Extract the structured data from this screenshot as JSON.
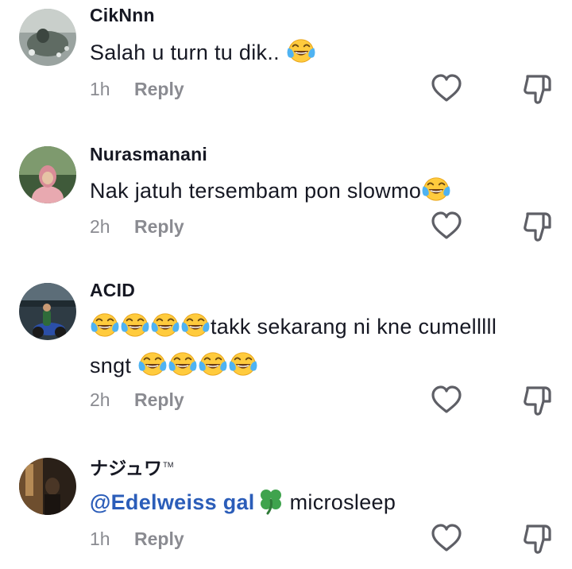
{
  "accent_colors": {
    "mention": "#2B5DB9",
    "meta_gray": "#8A8B91",
    "text": "#161823"
  },
  "comments": [
    {
      "username": "CikNnn",
      "text_parts": [
        "Salah u turn tu dik.. "
      ],
      "time": "1h",
      "reply_label": "Reply",
      "emojis": [
        "face-with-tears-of-joy"
      ]
    },
    {
      "username": "Nurasmanani",
      "text_parts": [
        "Nak jatuh tersembam pon slowmo"
      ],
      "time": "2h",
      "reply_label": "Reply",
      "emojis": [
        "face-with-tears-of-joy"
      ]
    },
    {
      "username": "ACID",
      "text_parts": [
        "takk sekarang ni kne cumelllll",
        "sngt "
      ],
      "time": "2h",
      "reply_label": "Reply",
      "emojis": [
        "face-with-tears-of-joy"
      ]
    },
    {
      "username": "ナジュワ",
      "username_suffix": "TM",
      "mention": "@Edelweiss  gal",
      "text_parts": [
        "microsleep"
      ],
      "time": "1h",
      "reply_label": "Reply",
      "emojis": [
        "four-leaf-clover"
      ]
    }
  ],
  "icons": {
    "like": "heart-outline-icon",
    "dislike": "thumbs-down-outline-icon"
  }
}
